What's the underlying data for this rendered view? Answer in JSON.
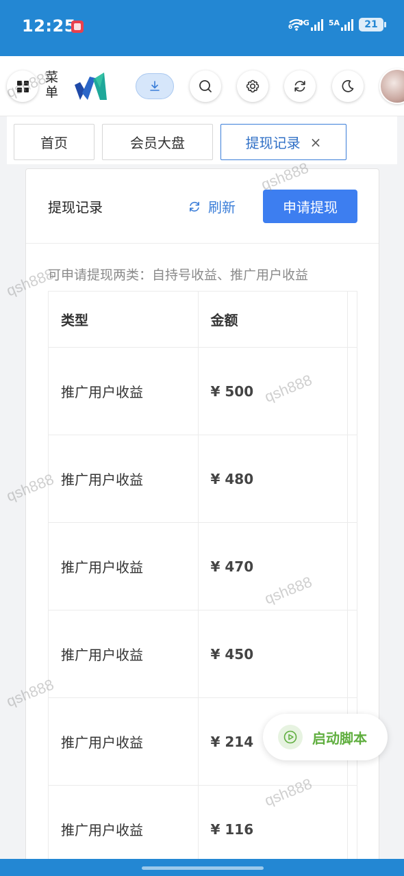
{
  "status_bar": {
    "time": "12:25",
    "wifi_badge": "6",
    "signal1": "4G",
    "signal2": "5A",
    "battery": "21"
  },
  "topnav": {
    "menu_label": "菜单",
    "icons": [
      "grid-menu-icon",
      "download-icon",
      "search-icon",
      "gear-icon",
      "refresh-icon",
      "moon-icon",
      "avatar"
    ],
    "accent": "#3d7ef0"
  },
  "tabs": [
    {
      "label": "首页"
    },
    {
      "label": "会员大盘"
    },
    {
      "label": "提现记录",
      "closable": true
    }
  ],
  "card": {
    "title": "提现记录",
    "refresh_label": "刷新",
    "apply_label": "申请提现",
    "hint": "可申请提现两类：自持号收益、推广用户收益"
  },
  "table": {
    "columns": [
      "类型",
      "金额"
    ],
    "rows": [
      {
        "type": "推广用户收益",
        "amount": "¥ 500"
      },
      {
        "type": "推广用户收益",
        "amount": "¥ 480"
      },
      {
        "type": "推广用户收益",
        "amount": "¥ 470"
      },
      {
        "type": "推广用户收益",
        "amount": "¥ 450"
      },
      {
        "type": "推广用户收益",
        "amount": "¥ 214"
      },
      {
        "type": "推广用户收益",
        "amount": "¥ 116"
      }
    ]
  },
  "float_button": {
    "label": "启动脚本"
  },
  "watermark": "qsh888"
}
